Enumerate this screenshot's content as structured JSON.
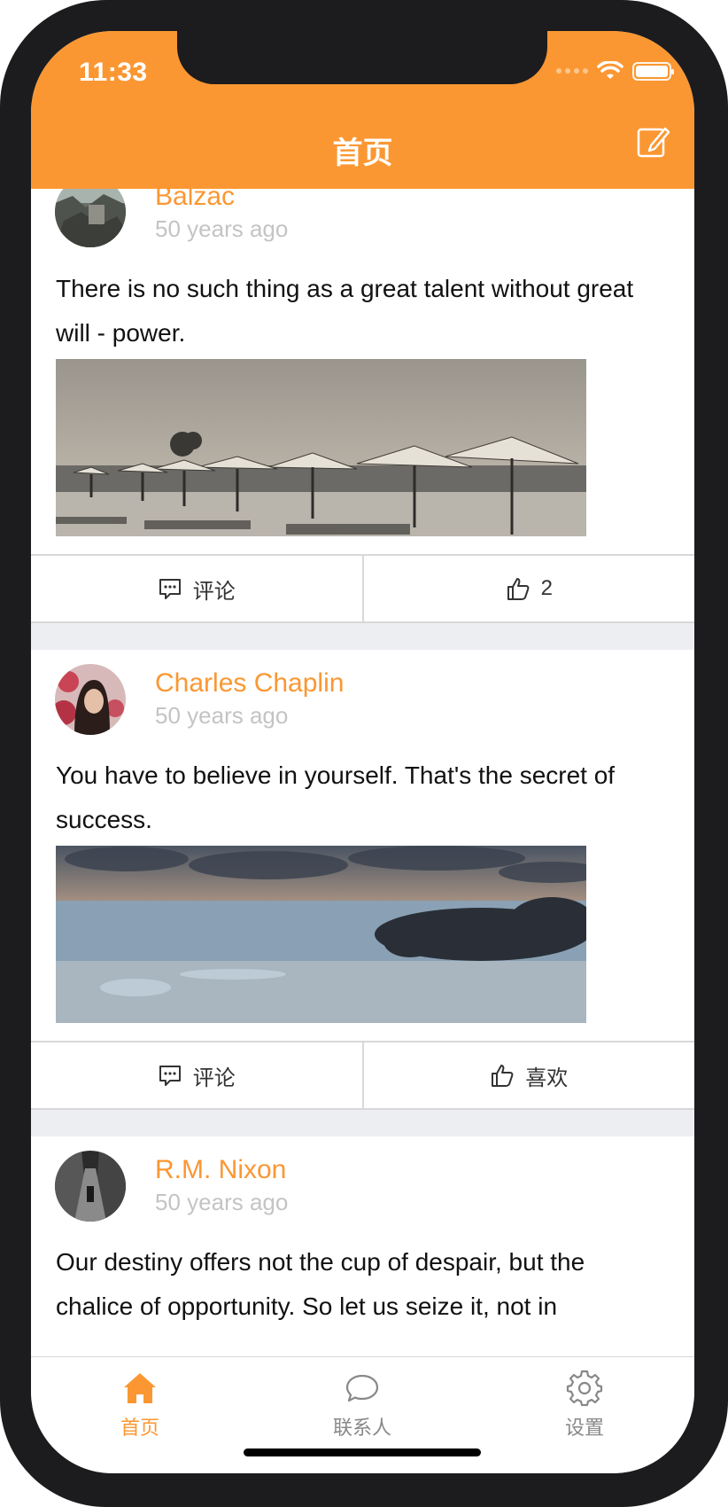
{
  "status": {
    "time": "11:33"
  },
  "nav": {
    "title": "首页"
  },
  "posts": [
    {
      "author": "Balzac",
      "time": "50 years ago",
      "text": "There is no such thing as a great talent without great will - power.",
      "actions": {
        "comment": "评论",
        "like": "2"
      }
    },
    {
      "author": "Charles Chaplin",
      "time": "50 years ago",
      "text": "You have to believe in yourself. That's the secret of success.",
      "actions": {
        "comment": "评论",
        "like": "喜欢"
      }
    },
    {
      "author": "R.M. Nixon",
      "time": "50 years ago",
      "text": "Our destiny offers not the cup of despair, but the chalice of opportunity. So let us seize it, not in"
    }
  ],
  "tabbar": {
    "items": [
      {
        "label": "首页",
        "icon": "home-icon",
        "active": true
      },
      {
        "label": "联系人",
        "icon": "chat-bubble-icon",
        "active": false
      },
      {
        "label": "设置",
        "icon": "gear-icon",
        "active": false
      }
    ]
  },
  "colors": {
    "accent": "#fb9732",
    "muted": "#c4c4c4",
    "separator": "#edeef1"
  }
}
